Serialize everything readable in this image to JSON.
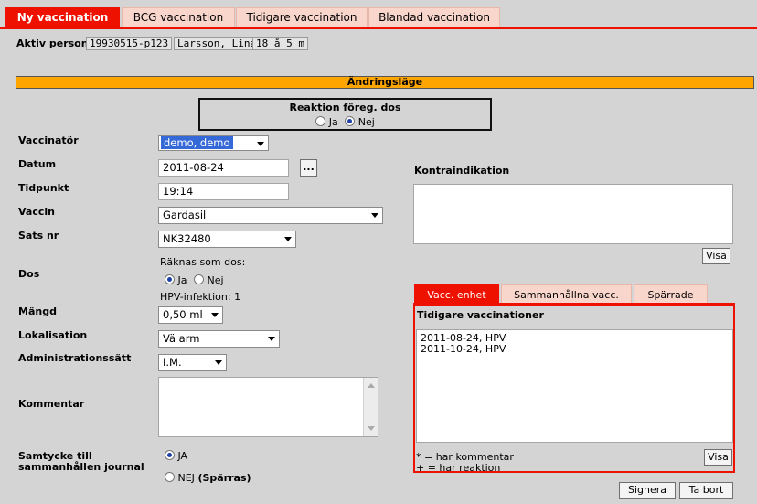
{
  "tabs": [
    {
      "label": "Ny vaccination",
      "active": true
    },
    {
      "label": "BCG vaccination",
      "active": false
    },
    {
      "label": "Tidigare vaccination",
      "active": false
    },
    {
      "label": "Blandad vaccination",
      "active": false
    }
  ],
  "person": {
    "label": "Aktiv person",
    "id": "19930515-p123",
    "name": "Larsson, Lina",
    "age": "18 å 5 m"
  },
  "mode_bar": "Ändringsläge",
  "reaction": {
    "title": "Reaktion föreg. dos",
    "yes": "Ja",
    "no": "Nej",
    "selected": "Nej"
  },
  "form": {
    "vaccinator": {
      "label": "Vaccinatör",
      "value": "demo, demo"
    },
    "date": {
      "label": "Datum",
      "value": "2011-08-24",
      "picker": "..."
    },
    "time": {
      "label": "Tidpunkt",
      "value": "19:14"
    },
    "vaccine": {
      "label": "Vaccin",
      "value": "Gardasil"
    },
    "batch": {
      "label": "Sats nr",
      "value": "NK32480"
    },
    "dose": {
      "label": "Dos",
      "counts_as": "Räknas som dos:",
      "yes": "Ja",
      "no": "Nej",
      "selected": "Ja",
      "hpv_info": "HPV-infektion: 1"
    },
    "amount": {
      "label": "Mängd",
      "value": "0,50 ml"
    },
    "location": {
      "label": "Lokalisation",
      "value": "Vä arm"
    },
    "admin": {
      "label": "Administrationssätt",
      "value": "I.M."
    },
    "comment": {
      "label": "Kommentar",
      "value": ""
    },
    "consent": {
      "label_line1": "Samtycke till",
      "label_line2": "sammanhållen journal",
      "yes": "JA",
      "no": "NEJ",
      "no_suffix": "(Spärras)",
      "selected": "JA"
    }
  },
  "contraindication": {
    "label": "Kontraindikation",
    "value": "",
    "button": "Visa"
  },
  "subtabs": [
    {
      "label": "Vacc. enhet",
      "active": true
    },
    {
      "label": "Sammanhållna vacc.",
      "active": false
    },
    {
      "label": "Spärrade",
      "active": false
    }
  ],
  "history": {
    "title": "Tidigare vaccinationer",
    "items": [
      "2011-08-24, HPV",
      "2011-10-24, HPV"
    ],
    "legend1": "* = har kommentar",
    "legend2": "+ = har reaktion",
    "button": "Visa"
  },
  "actions": {
    "sign": "Signera",
    "delete": "Ta bort"
  }
}
